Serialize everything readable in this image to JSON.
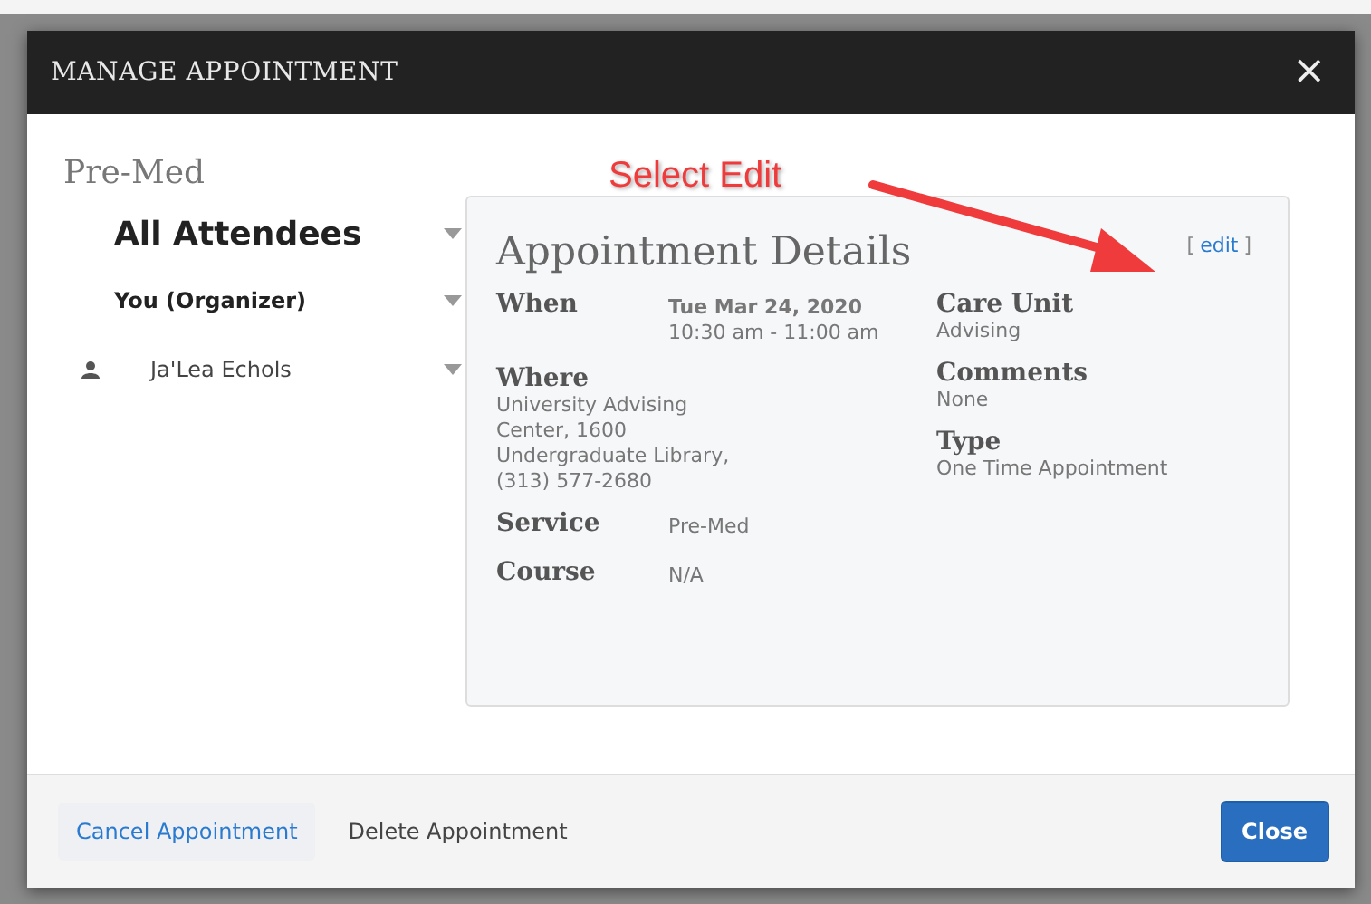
{
  "dialog": {
    "title": "MANAGE APPOINTMENT",
    "close": "×"
  },
  "service_heading": "Pre-Med",
  "attendees": [
    {
      "kind": "group",
      "name": "All Attendees"
    },
    {
      "kind": "organizer",
      "name": "You (Organizer)"
    },
    {
      "kind": "person",
      "name": "Ja'Lea Echols"
    }
  ],
  "details": {
    "title": "Appointment Details",
    "edit_link": {
      "open": "[",
      "label": "edit",
      "close": "]"
    },
    "left": [
      {
        "label": "When",
        "lines": [
          "**Tue Mar 24, 2020**",
          "10:30 am - 11:00 am"
        ],
        "kind": "inline"
      },
      {
        "label": "Where",
        "lines": [
          "University Advising",
          "Center, 1600",
          "Undergraduate Library,",
          "(313) 577-2680"
        ],
        "kind": "stacked"
      },
      {
        "label": "Service",
        "lines": [
          "Pre-Med"
        ],
        "kind": "inline"
      },
      {
        "label": "Course",
        "lines": [
          "N/A"
        ],
        "kind": "inline"
      }
    ],
    "right": [
      {
        "label": "Care Unit",
        "lines": [
          "Advising"
        ],
        "kind": "stacked"
      },
      {
        "label": "Comments",
        "lines": [
          "None"
        ],
        "kind": "stacked"
      },
      {
        "label": "Type",
        "lines": [
          "One Time Appointment"
        ],
        "kind": "stacked"
      }
    ]
  },
  "footer": {
    "buttons": [
      {
        "label": "Cancel Appointment",
        "kind": "link"
      },
      {
        "label": "Delete Appointment",
        "kind": "plain"
      },
      {
        "label": "Close",
        "kind": "primary"
      }
    ]
  },
  "annotation": {
    "text": "Select Edit"
  }
}
